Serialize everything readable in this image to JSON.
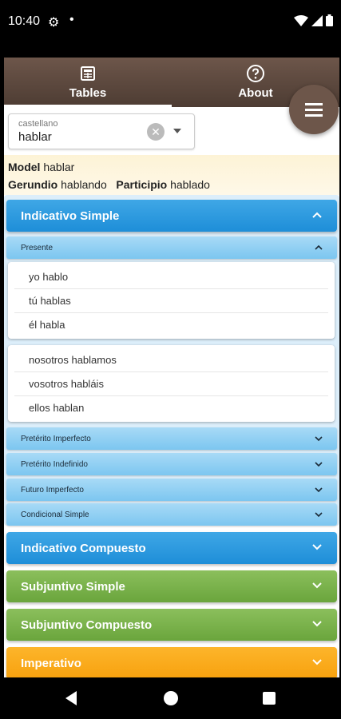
{
  "status_bar": {
    "time": "10:40"
  },
  "tabs": [
    {
      "label": "Tables",
      "icon": "table-icon",
      "active": true
    },
    {
      "label": "About",
      "icon": "help-circle-icon",
      "active": false
    }
  ],
  "fab": {
    "icon": "menu-icon"
  },
  "language_select": {
    "label": "castellano",
    "value": "hablar"
  },
  "model": {
    "model_label": "Model",
    "model_value": "hablar",
    "gerund_label": "Gerundio",
    "gerund_value": "hablando",
    "participle_label": "Participio",
    "participle_value": "hablado"
  },
  "sections": {
    "indicativo_simple": "Indicativo Simple",
    "presente": "Presente",
    "preterito_imperfecto": "Pretérito Imperfecto",
    "preterito_indefinido": "Pretérito Indefinido",
    "futuro_imperfecto": "Futuro Imperfecto",
    "condicional_simple": "Condicional Simple",
    "indicativo_compuesto": "Indicativo Compuesto",
    "subjuntivo_simple": "Subjuntivo Simple",
    "subjuntivo_compuesto": "Subjuntivo Compuesto",
    "imperativo": "Imperativo"
  },
  "conjugation": {
    "singular": [
      "yo hablo",
      "tú hablas",
      "él habla"
    ],
    "plural": [
      "nosotros hablamos",
      "vosotros habláis",
      "ellos hablan"
    ]
  },
  "colors": {
    "brown": "#6d564a",
    "blue": "#1e8ed8",
    "green": "#6aa53c",
    "orange": "#f7a10e"
  }
}
